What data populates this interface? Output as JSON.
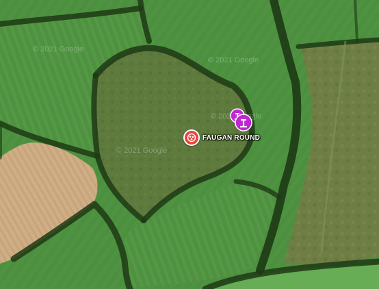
{
  "map": {
    "type": "satellite",
    "watermarks": [
      "© 2021 Google",
      "© 2021 Google",
      "© 2021 Google",
      "© 2021 Google"
    ],
    "colors": {
      "grass": "#4c8f3f",
      "grass_light": "#5aa04a",
      "field_center": "#5e7a3c",
      "hedge": "#1d3a14",
      "plowed": "#cfae86",
      "marker_red": "#e8453c",
      "marker_purple": "#c026d3"
    }
  },
  "poi": {
    "label": "FAUGAN ROUND",
    "icon": "historical-site-icon"
  },
  "pins": [
    {
      "icon": "monument-pin-icon"
    },
    {
      "icon": "monument-pin-icon"
    }
  ]
}
